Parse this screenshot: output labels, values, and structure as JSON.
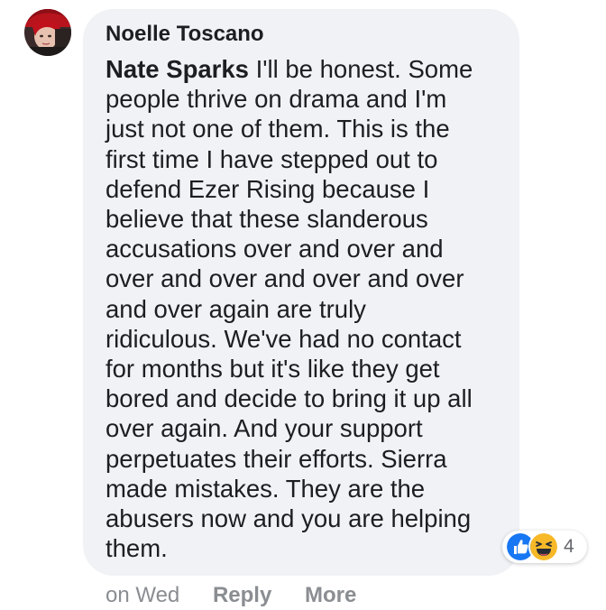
{
  "comment": {
    "author": "Noelle Toscano",
    "mention": "Nate Sparks",
    "lines": [
      " I'll be honest. Some",
      "people thrive on drama and I'm",
      "just not one of them. This is the",
      "first time I have stepped out to",
      "defend Ezer Rising because I",
      "believe that these slanderous",
      "accusations over and over and",
      "over and over and over and over",
      "and over again are truly",
      "ridiculous. We've had no contact",
      "for months but it's like they get",
      "bored and decide to bring it up all",
      "over again. And your support",
      "perpetuates their efforts. Sierra",
      "made mistakes. They are the",
      "abusers now and you are helping",
      "them."
    ]
  },
  "reactions": {
    "icons": [
      "like-icon",
      "haha-icon"
    ],
    "count": "4",
    "colors": {
      "like": "#1877f2",
      "haha": "#f7b928"
    }
  },
  "actions": {
    "timestamp": "on Wed",
    "reply": "Reply",
    "more": "More"
  },
  "colors": {
    "bubble": "#f0f2f5",
    "text": "#1c1e21",
    "muted": "#8a8d91"
  }
}
